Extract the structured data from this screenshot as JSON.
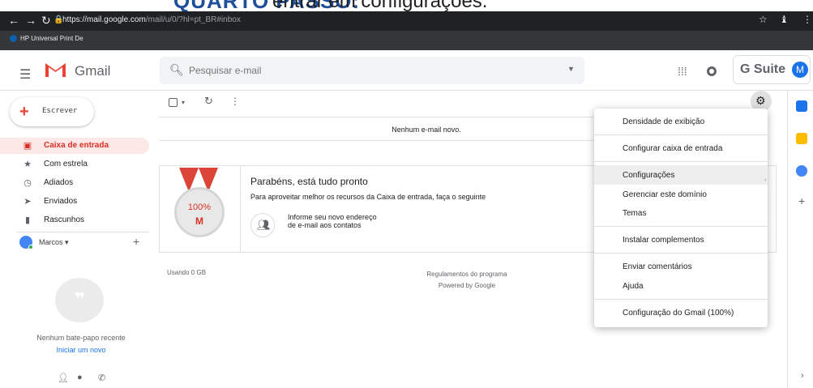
{
  "overlay": {
    "step": "QUARTO PASSO:",
    "text": "entrar em configurações."
  },
  "browser": {
    "url_host": "https://mail.google.com",
    "url_path": "/mail/u/0/?hl=pt_BR#inbox",
    "bookmark": "HP Universal Print De"
  },
  "header": {
    "logo_text": "Gmail",
    "search_placeholder": "Pesquisar e-mail",
    "gsuite_label": "G Suite",
    "avatar_letter": "M"
  },
  "sidebar": {
    "compose_label": "Escrever",
    "items": [
      {
        "label": "Caixa de entrada",
        "icon": "inbox-icon",
        "active": true
      },
      {
        "label": "Com estrela",
        "icon": "star-icon"
      },
      {
        "label": "Adiados",
        "icon": "clock-icon"
      },
      {
        "label": "Enviados",
        "icon": "send-icon"
      },
      {
        "label": "Rascunhos",
        "icon": "draft-icon"
      }
    ],
    "user_name": "Marcos",
    "chat_empty": "Nenhum bate-papo recente",
    "chat_start": "Iniciar um novo"
  },
  "main": {
    "empty_message": "Nenhum e-mail novo.",
    "card_title": "Parabéns, está tudo pronto",
    "card_subtitle": "Para aproveitar melhor os recursos da Caixa de entrada, faça o seguinte",
    "medal_pct": "100%",
    "medal_letter": "M",
    "task_text": "Informe seu novo endereço de e-mail aos contatos",
    "card_link": "s",
    "usage": "Usando 0 GB",
    "terms_line1": "Regulamentos do programa",
    "terms_line2": "Powered by Google"
  },
  "settings_menu": {
    "items": [
      "Densidade de exibição",
      "Configurar caixa de entrada",
      "Configurações",
      "Gerenciar este domínio",
      "Temas",
      "Instalar complementos",
      "Enviar comentários",
      "Ajuda",
      "Configuração do Gmail (100%)"
    ],
    "highlighted": "Configurações"
  },
  "colors": {
    "accent_red": "#d93025",
    "accent_blue": "#1a73e8",
    "chrome_dark": "#35363a"
  }
}
